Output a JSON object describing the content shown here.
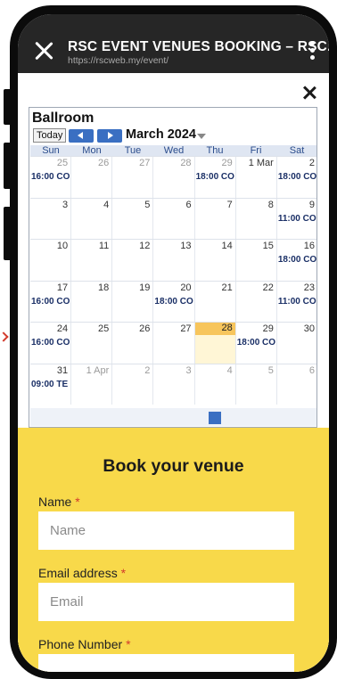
{
  "browser": {
    "title": "RSC EVENT VENUES BOOKING – RSC...",
    "url": "https://rscweb.my/event/"
  },
  "calendar": {
    "title": "Ballroom",
    "today_label": "Today",
    "month_label": "March 2024",
    "weekdays": [
      "Sun",
      "Mon",
      "Tue",
      "Wed",
      "Thu",
      "Fri",
      "Sat"
    ],
    "weeks": [
      [
        {
          "d": "25",
          "o": true,
          "e": "16:00 CO"
        },
        {
          "d": "26",
          "o": true
        },
        {
          "d": "27",
          "o": true
        },
        {
          "d": "28",
          "o": true
        },
        {
          "d": "29",
          "o": true,
          "e": "18:00 CO"
        },
        {
          "d": "1 Mar"
        },
        {
          "d": "2",
          "e": "18:00 CO"
        }
      ],
      [
        {
          "d": "3"
        },
        {
          "d": "4"
        },
        {
          "d": "5"
        },
        {
          "d": "6"
        },
        {
          "d": "7"
        },
        {
          "d": "8"
        },
        {
          "d": "9",
          "e": "11:00 CO"
        }
      ],
      [
        {
          "d": "10"
        },
        {
          "d": "11"
        },
        {
          "d": "12"
        },
        {
          "d": "13"
        },
        {
          "d": "14"
        },
        {
          "d": "15"
        },
        {
          "d": "16",
          "e": "18:00 CO"
        }
      ],
      [
        {
          "d": "17",
          "e": "16:00 CO"
        },
        {
          "d": "18"
        },
        {
          "d": "19"
        },
        {
          "d": "20",
          "e": "18:00 CO"
        },
        {
          "d": "21"
        },
        {
          "d": "22"
        },
        {
          "d": "23",
          "e": "11:00 CO"
        }
      ],
      [
        {
          "d": "24",
          "e": "16:00 CO"
        },
        {
          "d": "25"
        },
        {
          "d": "26"
        },
        {
          "d": "27"
        },
        {
          "d": "28",
          "today": true
        },
        {
          "d": "29",
          "e": "18:00 CO"
        },
        {
          "d": "30"
        }
      ],
      [
        {
          "d": "31",
          "e": "09:00 TE"
        },
        {
          "d": "1 Apr",
          "o": true
        },
        {
          "d": "2",
          "o": true
        },
        {
          "d": "3",
          "o": true
        },
        {
          "d": "4",
          "o": true
        },
        {
          "d": "5",
          "o": true
        },
        {
          "d": "6",
          "o": true
        }
      ]
    ]
  },
  "form": {
    "heading": "Book your venue",
    "name_label": "Name",
    "name_placeholder": "Name",
    "email_label": "Email address",
    "email_placeholder": "Email",
    "phone_label": "Phone Number",
    "required_mark": "*"
  }
}
